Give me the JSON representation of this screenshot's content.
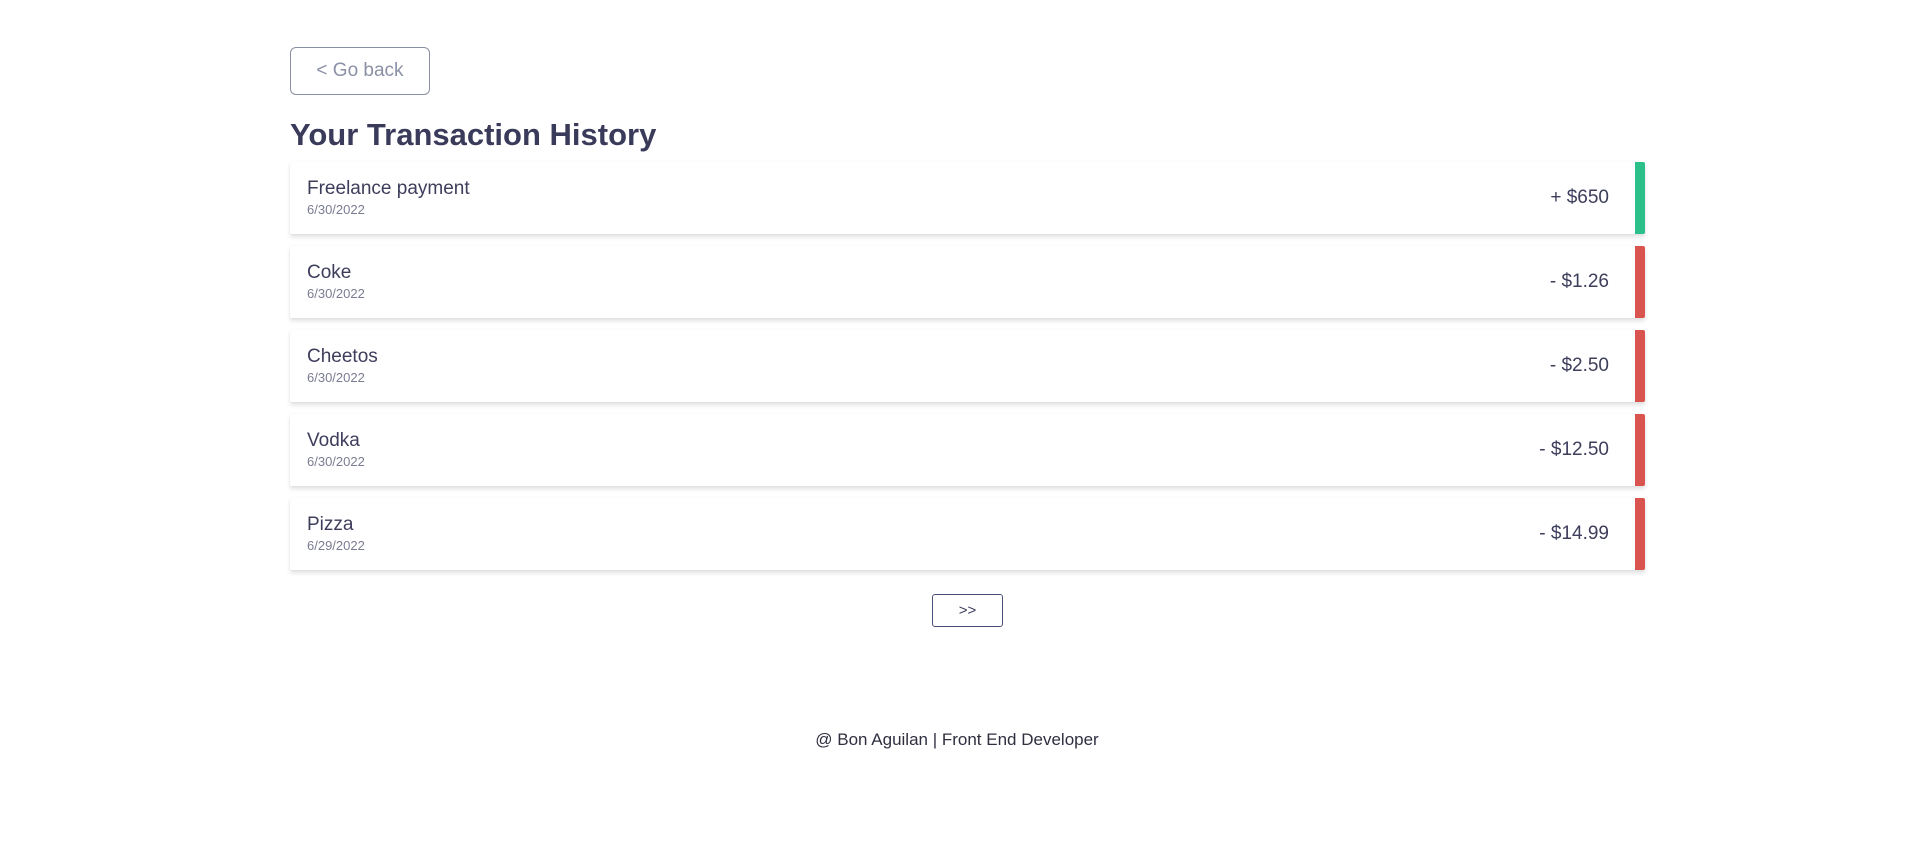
{
  "back_button": {
    "label": "< Go back"
  },
  "title": "Your Transaction History",
  "transactions": [
    {
      "name": "Freelance payment",
      "date": "6/30/2022",
      "amount": "+ $650"
    },
    {
      "name": "Coke",
      "date": "6/30/2022",
      "amount": "- $1.26"
    },
    {
      "name": "Cheetos",
      "date": "6/30/2022",
      "amount": "- $2.50"
    },
    {
      "name": "Vodka",
      "date": "6/30/2022",
      "amount": "- $12.50"
    },
    {
      "name": "Pizza",
      "date": "6/29/2022",
      "amount": "- $14.99"
    }
  ],
  "pager": {
    "next_label": ">>"
  },
  "footer": "@ Bon Aguilan | Front End Developer",
  "colors": {
    "income": "#2bbf8a",
    "expense": "#d9534f",
    "text": "#3d3d5c"
  }
}
